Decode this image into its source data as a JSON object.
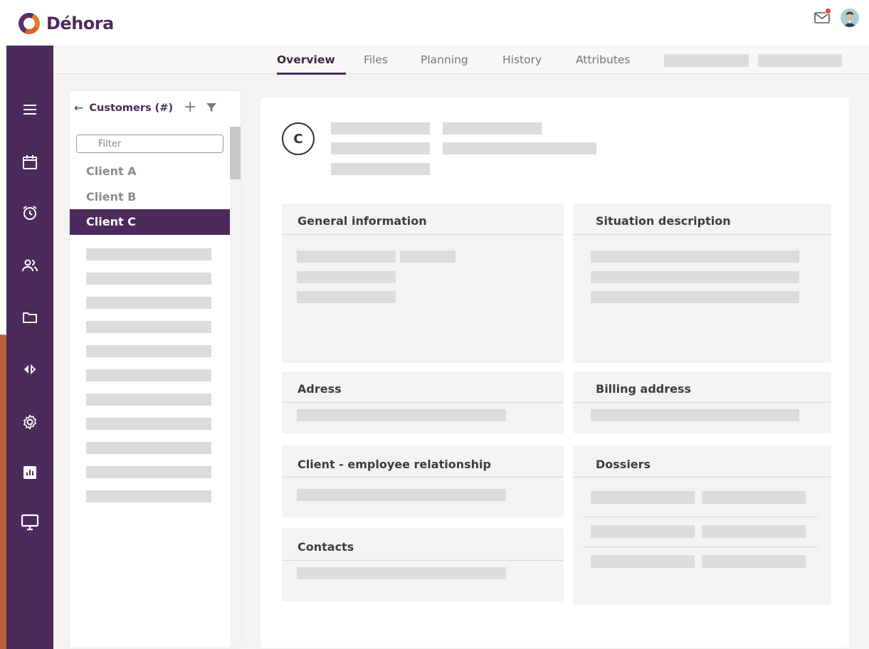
{
  "app": {
    "name": "Déhora"
  },
  "header": {
    "mail_icon": "mail-icon",
    "avatar_icon": "user-avatar"
  },
  "sidebar": {
    "items": [
      {
        "icon": "menu-icon"
      },
      {
        "icon": "calendar-icon"
      },
      {
        "icon": "alarm-clock-icon"
      },
      {
        "icon": "users-icon"
      },
      {
        "icon": "folder-icon"
      },
      {
        "icon": "code-arrows-icon"
      },
      {
        "icon": "settings-icon"
      },
      {
        "icon": "chart-icon"
      },
      {
        "icon": "monitor-icon"
      }
    ]
  },
  "tabs": [
    {
      "label": "Overview",
      "active": true
    },
    {
      "label": "Files",
      "active": false
    },
    {
      "label": "Planning",
      "active": false
    },
    {
      "label": "History",
      "active": false
    },
    {
      "label": "Attributes",
      "active": false
    }
  ],
  "customers": {
    "back_icon": "←",
    "title": "Customers (#)",
    "add_icon": "+",
    "filter_placeholder": "Filter",
    "items": [
      {
        "label": "Client A",
        "selected": false
      },
      {
        "label": "Client B",
        "selected": false
      },
      {
        "label": "Client C",
        "selected": true
      }
    ]
  },
  "detail": {
    "avatar_letter": "C",
    "cards": {
      "general": "General information",
      "situation": "Situation description",
      "address": "Adress",
      "billing": "Billing address",
      "relationship": "Client - employee relationship",
      "dossiers": "Dossiers",
      "contacts": "Contacts"
    }
  },
  "colors": {
    "brand_purple": "#4c2b5c",
    "brand_orange": "#e07d2a",
    "placeholder_gray": "#dcdcde",
    "card_bg": "#f3f3f4"
  }
}
